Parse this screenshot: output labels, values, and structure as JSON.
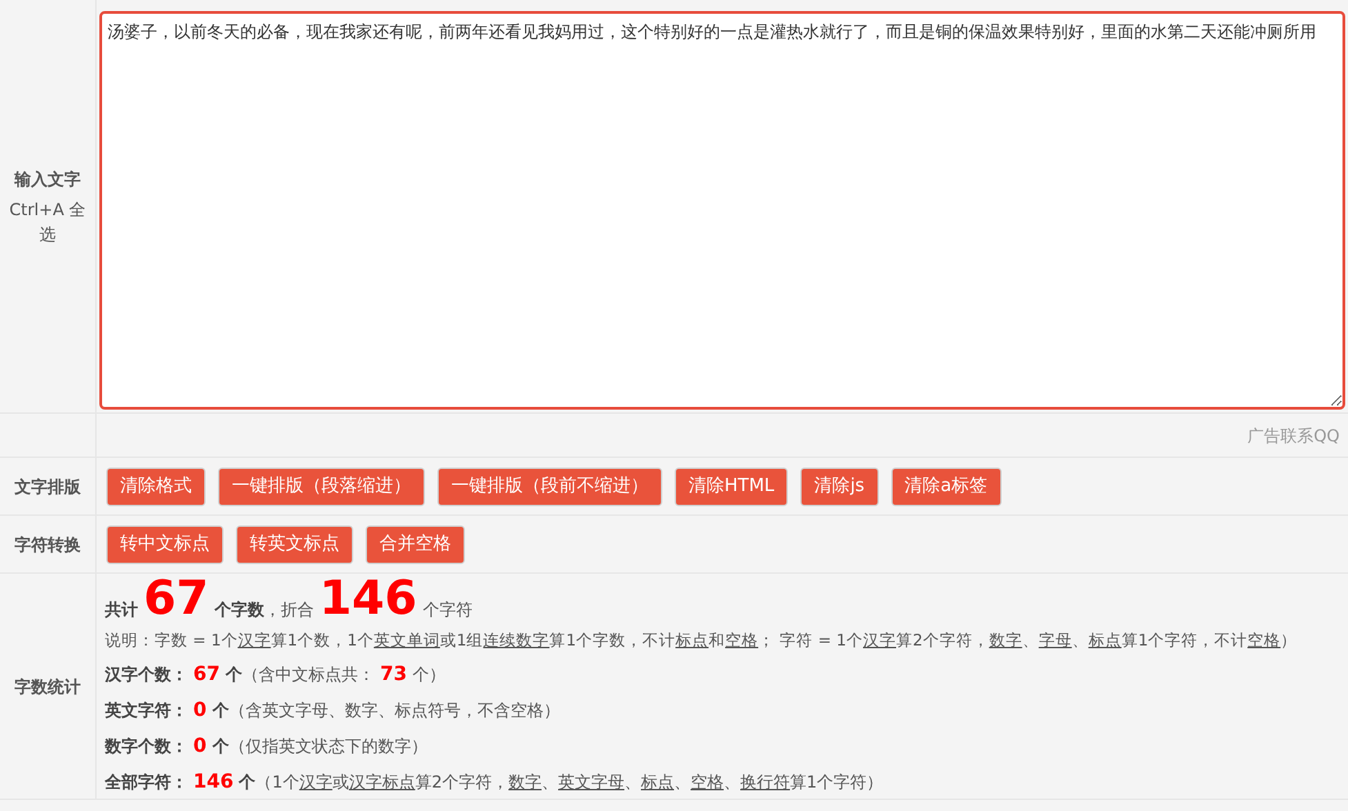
{
  "input_row": {
    "label": "输入文字",
    "hint": "Ctrl+A 全选",
    "value": "汤婆子，以前冬天的必备，现在我家还有呢，前两年还看见我妈用过，这个特别好的一点是灌热水就行了，而且是铜的保温效果特别好，里面的水第二天还能冲厕所用"
  },
  "ad_text": "广告联系QQ",
  "button_rows": [
    {
      "label": "文字排版",
      "buttons": [
        "清除格式",
        "一键排版（段落缩进）",
        "一键排版（段前不缩进）",
        "清除HTML",
        "清除js",
        "清除a标签"
      ]
    },
    {
      "label": "字符转换",
      "buttons": [
        "转中文标点",
        "转英文标点",
        "合并空格"
      ]
    }
  ],
  "stats": {
    "label": "字数统计",
    "summary": [
      {
        "kind": "label",
        "text": "共计"
      },
      {
        "kind": "big",
        "text": "67"
      },
      {
        "kind": "label",
        "text": "个字数"
      },
      {
        "kind": "text",
        "text": "，折合"
      },
      {
        "kind": "big",
        "text": "146"
      },
      {
        "kind": "text",
        "text": "个字符"
      }
    ],
    "explanation": [
      {
        "kind": "text",
        "text": "说明：字数 = 1个"
      },
      {
        "kind": "link",
        "text": "汉字"
      },
      {
        "kind": "text",
        "text": "算1个数，1个"
      },
      {
        "kind": "link",
        "text": "英文单词"
      },
      {
        "kind": "text",
        "text": "或1组"
      },
      {
        "kind": "link",
        "text": "连续数字"
      },
      {
        "kind": "text",
        "text": "算1个字数，不计"
      },
      {
        "kind": "link",
        "text": "标点"
      },
      {
        "kind": "text",
        "text": "和"
      },
      {
        "kind": "link",
        "text": "空格"
      },
      {
        "kind": "text",
        "text": "； 字符 = 1个"
      },
      {
        "kind": "link",
        "text": "汉字"
      },
      {
        "kind": "text",
        "text": "算2个字符，"
      },
      {
        "kind": "link",
        "text": "数字"
      },
      {
        "kind": "text",
        "text": "、"
      },
      {
        "kind": "link",
        "text": "字母"
      },
      {
        "kind": "text",
        "text": "、"
      },
      {
        "kind": "link",
        "text": "标点"
      },
      {
        "kind": "text",
        "text": "算1个字符，不计"
      },
      {
        "kind": "link",
        "text": "空格"
      },
      {
        "kind": "text",
        "text": "）"
      }
    ],
    "lines": [
      [
        {
          "kind": "label",
          "text": "汉字个数："
        },
        {
          "kind": "value",
          "text": "67"
        },
        {
          "kind": "label",
          "text": "个"
        },
        {
          "kind": "text",
          "text": "（含中文标点共："
        },
        {
          "kind": "value",
          "text": "73"
        },
        {
          "kind": "text",
          "text": "个）"
        }
      ],
      [
        {
          "kind": "label",
          "text": "英文字符："
        },
        {
          "kind": "value",
          "text": "0"
        },
        {
          "kind": "label",
          "text": "个"
        },
        {
          "kind": "text",
          "text": "（含英文字母、数字、标点符号，不含空格）"
        }
      ],
      [
        {
          "kind": "label",
          "text": "数字个数："
        },
        {
          "kind": "value",
          "text": "0"
        },
        {
          "kind": "label",
          "text": "个"
        },
        {
          "kind": "text",
          "text": "（仅指英文状态下的数字）"
        }
      ],
      [
        {
          "kind": "label",
          "text": "全部字符："
        },
        {
          "kind": "value",
          "text": "146"
        },
        {
          "kind": "label",
          "text": "个"
        },
        {
          "kind": "text",
          "text": "（1个"
        },
        {
          "kind": "link",
          "text": "汉字"
        },
        {
          "kind": "text",
          "text": "或"
        },
        {
          "kind": "link",
          "text": "汉字标点"
        },
        {
          "kind": "text",
          "text": "算2个字符，"
        },
        {
          "kind": "link",
          "text": "数字"
        },
        {
          "kind": "text",
          "text": "、"
        },
        {
          "kind": "link",
          "text": "英文字母"
        },
        {
          "kind": "text",
          "text": "、"
        },
        {
          "kind": "link",
          "text": "标点"
        },
        {
          "kind": "text",
          "text": "、"
        },
        {
          "kind": "link",
          "text": "空格"
        },
        {
          "kind": "text",
          "text": "、"
        },
        {
          "kind": "link",
          "text": "换行符"
        },
        {
          "kind": "text",
          "text": "算1个字符）"
        }
      ]
    ]
  }
}
